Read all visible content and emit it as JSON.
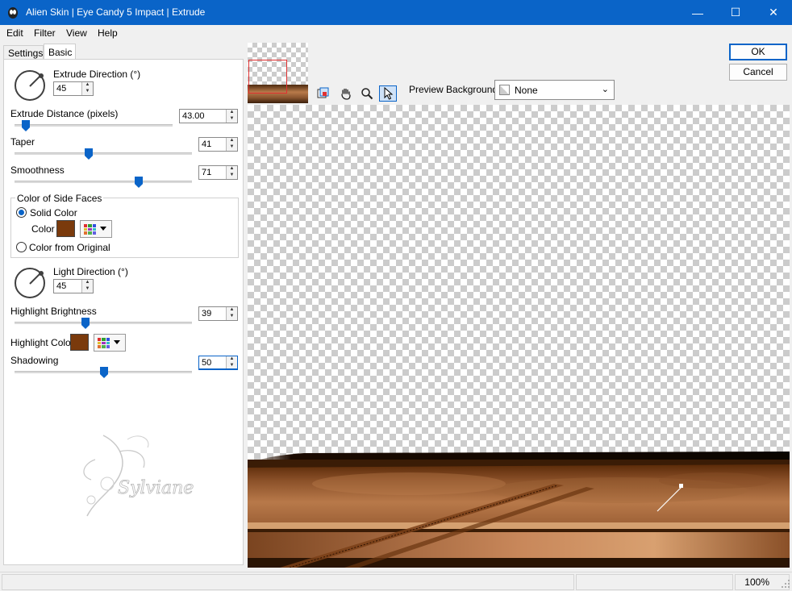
{
  "window": {
    "title": "Alien Skin | Eye Candy 5 Impact | Extrude",
    "minimize": "—",
    "maximize": "☐",
    "close": "✕"
  },
  "menu": {
    "edit": "Edit",
    "filter": "Filter",
    "view": "View",
    "help": "Help"
  },
  "tabs": {
    "settings": "Settings",
    "basic": "Basic"
  },
  "controls": {
    "extrude_direction": {
      "label": "Extrude Direction (°)",
      "value": "45"
    },
    "extrude_distance": {
      "label": "Extrude Distance (pixels)",
      "value": "43.00",
      "level": 0.06
    },
    "taper": {
      "label": "Taper",
      "value": "41",
      "level": 0.41
    },
    "smoothness": {
      "label": "Smoothness",
      "value": "71",
      "level": 0.71
    },
    "side_faces": {
      "group_label": "Color of Side Faces",
      "solid_color": "Solid Color",
      "color_label": "Color",
      "color_from_original": "Color from Original",
      "color": "#7a3a0c"
    },
    "light_direction": {
      "label": "Light Direction (°)",
      "value": "45"
    },
    "highlight_brightness": {
      "label": "Highlight Brightness",
      "value": "39",
      "level": 0.39
    },
    "highlight_color": {
      "label": "Highlight Color",
      "color": "#7a3a0c"
    },
    "shadowing": {
      "label": "Shadowing",
      "value": "50",
      "level": 0.5
    }
  },
  "watermark": "Sylviane",
  "preview_bar": {
    "background_label": "Preview Background:",
    "background_value": "None",
    "tools": [
      "navigator-icon",
      "hand-icon",
      "zoom-icon",
      "pointer-icon"
    ]
  },
  "buttons": {
    "ok": "OK",
    "cancel": "Cancel"
  },
  "status": {
    "zoom": "100%"
  },
  "colors": {
    "accent": "#0a64c8",
    "wood_dark": "#4a2408",
    "wood_mid": "#a86a3e",
    "wood_light": "#d6a070"
  }
}
